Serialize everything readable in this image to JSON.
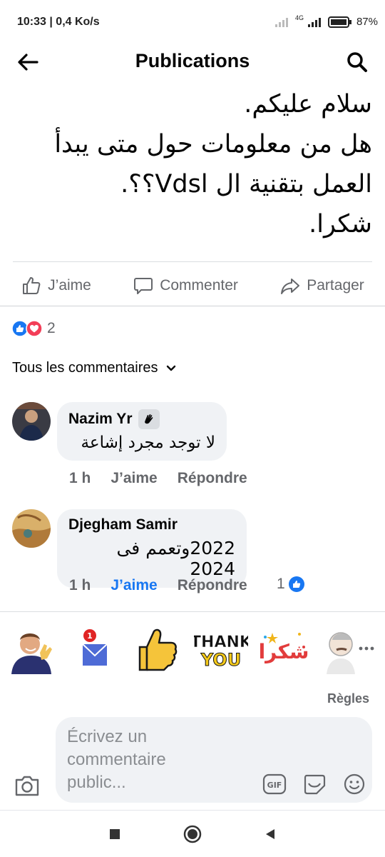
{
  "status": {
    "time": "10:33 | 0,4 Ko/s",
    "net": "4G",
    "battery": "87%"
  },
  "header": {
    "title": "Publications"
  },
  "post": {
    "lines": [
      "سلام عليكم.",
      "هل من معلومات حول متى يبدأ",
      "العمل بتقنية ال Vdsl؟؟.",
      "شكرا."
    ]
  },
  "actions": {
    "like": "J’aime",
    "comment": "Commenter",
    "share": "Partager"
  },
  "reactions": {
    "count": "2"
  },
  "filter": {
    "label": "Tous les commentaires"
  },
  "comments": [
    {
      "name": "Nazim Yr",
      "text": "لا توجد مجرد إشاعة",
      "time": "1 h",
      "like": "J’aime",
      "reply": "Répondre",
      "reactions": ""
    },
    {
      "name": "Djegham Samir",
      "text": "2022وتعمم فى 2024",
      "time": "1 h",
      "like": "J’aime",
      "reply": "Répondre",
      "reactions": "1"
    }
  ],
  "stickers": {
    "items": [
      "wave-person-sticker",
      "mail-notification-sticker",
      "thumbs-up-sticker",
      "thank-you-sticker",
      "shukran-sticker",
      "man-sticker"
    ],
    "thank_line1": "THANK",
    "thank_line2": "YOU",
    "shukran": "شكرا"
  },
  "rules": {
    "label": "Règles"
  },
  "composer": {
    "placeholder": "Écrivez un commentaire public...",
    "gif": "GIF"
  },
  "colors": {
    "accent": "#1877f2",
    "love": "#f33e58",
    "bubble": "#f0f2f5",
    "muted": "#65676b"
  }
}
